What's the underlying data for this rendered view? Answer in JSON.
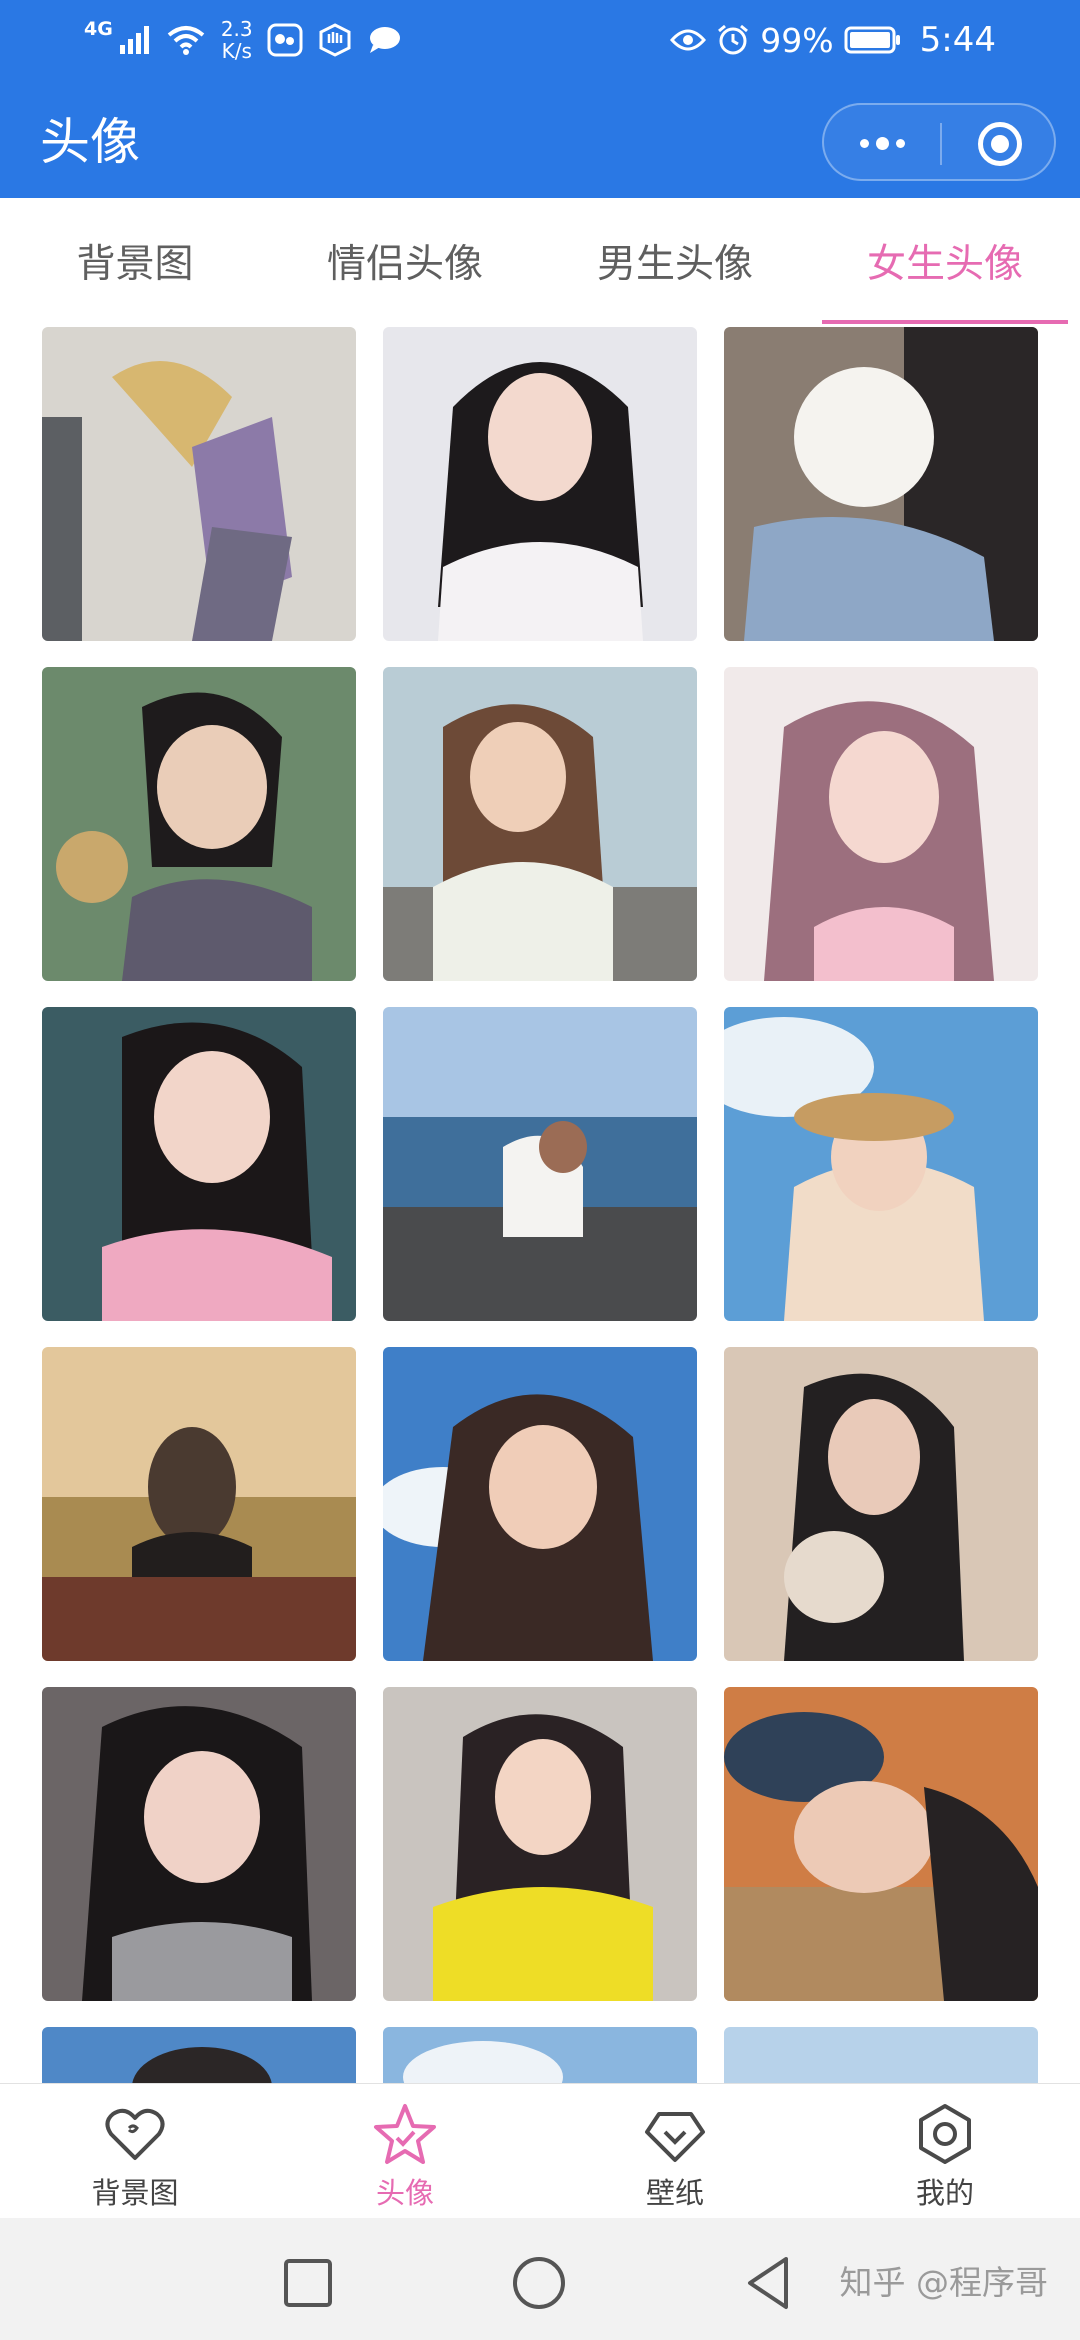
{
  "status_bar": {
    "network_type": "4G",
    "speed_value": "2.3",
    "speed_unit": "K/s",
    "battery_percent": "99%",
    "time": "5:44",
    "icons": [
      "signal-icon",
      "wifi-icon",
      "app-notification-icon",
      "app-notification-icon-2",
      "chat-bubble-icon",
      "eye-icon",
      "alarm-icon",
      "battery-icon"
    ]
  },
  "header": {
    "title": "头像",
    "capsule": {
      "more_icon": "more-dots-icon",
      "close_icon": "target-circle-icon"
    }
  },
  "tabs": [
    {
      "label": "背景图",
      "active": false
    },
    {
      "label": "情侣头像",
      "active": false
    },
    {
      "label": "男生头像",
      "active": false
    },
    {
      "label": "女生头像",
      "active": true
    }
  ],
  "grid": {
    "columns": 3,
    "visible_rows": 6,
    "items": [
      "avatar-photo-1",
      "avatar-photo-2",
      "avatar-photo-3",
      "avatar-photo-4",
      "avatar-photo-5",
      "avatar-photo-6",
      "avatar-photo-7",
      "avatar-photo-8",
      "avatar-photo-9",
      "avatar-photo-10",
      "avatar-photo-11",
      "avatar-photo-12",
      "avatar-photo-13",
      "avatar-photo-14",
      "avatar-photo-15",
      "avatar-photo-16",
      "avatar-photo-17",
      "avatar-photo-18"
    ]
  },
  "bottom_nav": [
    {
      "label": "背景图",
      "icon": "heart-badge-icon",
      "active": false
    },
    {
      "label": "头像",
      "icon": "star-icon",
      "active": true
    },
    {
      "label": "壁纸",
      "icon": "diamond-icon",
      "active": false
    },
    {
      "label": "我的",
      "icon": "hexagon-icon",
      "active": false
    }
  ],
  "system_nav": {
    "icons": [
      "recent-apps-icon",
      "home-icon",
      "back-icon"
    ]
  },
  "watermark": "知乎 @程序哥",
  "colors": {
    "header_blue": "#2a78e4",
    "accent_pink": "#e66bb2",
    "text_gray": "#5f5f5f"
  }
}
